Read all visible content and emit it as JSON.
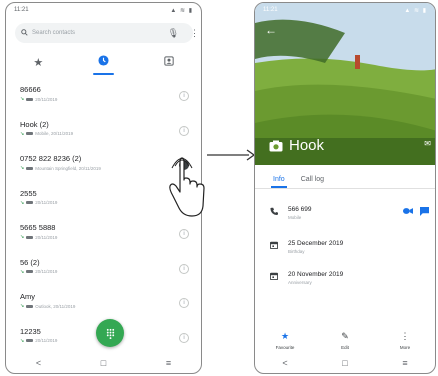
{
  "left_phone": {
    "status_time": "11:21",
    "status_icons": "▲ ≋ ▮",
    "search": {
      "placeholder": "Search contacts"
    },
    "tabs": {
      "favourites_icon": "star-icon",
      "recents_icon": "clock-icon",
      "contacts_icon": "contacts-icon",
      "active": "recents"
    },
    "calls": [
      {
        "name": "86666",
        "detail": "20/11/2019"
      },
      {
        "name": "Hook (2)",
        "detail": "Mobile, 20/11/2019"
      },
      {
        "name": "0752 822 8236 (2)",
        "detail": "Mountain Springfield, 20/11/2019"
      },
      {
        "name": "2555",
        "detail": "20/11/2019"
      },
      {
        "name": "5665 5888",
        "detail": "20/11/2019"
      },
      {
        "name": "56 (2)",
        "detail": "20/11/2019"
      },
      {
        "name": "Amy",
        "detail": "Outlook, 20/11/2019"
      },
      {
        "name": "12235",
        "detail": "20/11/2019"
      }
    ],
    "pressed_row_index": 2,
    "fab_icon": "dialpad-icon",
    "nav": {
      "back": "<",
      "home": "□",
      "recents": "≡"
    }
  },
  "right_phone": {
    "status_time": "11:21",
    "status_icons": "▲ ≋ ▮",
    "contact_name": "Hook",
    "tabs": {
      "info": "Info",
      "call_log": "Call log",
      "active": "info"
    },
    "phone": {
      "number": "566 699",
      "type": "Mobile"
    },
    "events": [
      {
        "date": "25 December 2019",
        "type": "Birthday"
      },
      {
        "date": "20 November 2019",
        "type": "Anniversary"
      }
    ],
    "actions": {
      "favourite": "Favourite",
      "edit": "Edit",
      "more": "More"
    },
    "nav": {
      "back": "<",
      "home": "□",
      "recents": "≡"
    }
  },
  "colors": {
    "accent": "#1a73e8",
    "fab": "#34a853",
    "grass": "#7cb342",
    "sky": "#c8dceb"
  }
}
